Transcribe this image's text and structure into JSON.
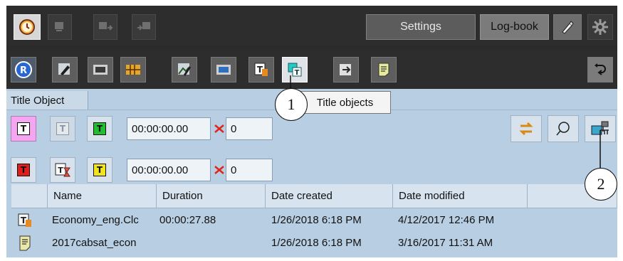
{
  "toolbar_top": {
    "settings_label": "Settings",
    "logbook_label": "Log-book",
    "icons": [
      "clock-icon",
      "monitor-icon",
      "monitor-out-icon",
      "monitor-in-icon",
      "pen-icon",
      "gear-icon"
    ]
  },
  "toolbar_second": {
    "icons": [
      "r-badge-icon",
      "edit-icon",
      "film-icon",
      "template-icon",
      "image-edit-icon",
      "clip-icon",
      "title-object-icon",
      "title-objects-icon",
      "export-icon",
      "notes-icon",
      "undo-arrow-icon"
    ]
  },
  "tooltip": {
    "text": "Title objects"
  },
  "tab": {
    "label": "Title Object"
  },
  "row1": {
    "time": "00:00:00.00",
    "count": "0"
  },
  "row2": {
    "time": "00:00:00.00",
    "count": "0"
  },
  "callouts": [
    "1",
    "2"
  ],
  "table": {
    "columns": [
      "Name",
      "Duration",
      "Date created",
      "Date modified"
    ],
    "rows": [
      {
        "icon": "title-file-icon",
        "name": "Economy_eng.Clc",
        "duration": "00:00:27.88",
        "created": "1/26/2018 6:18 PM",
        "modified": "4/12/2017 12:46 PM"
      },
      {
        "icon": "document-icon",
        "name": "2017cabsat_econ",
        "duration": "",
        "created": "1/26/2018 6:18 PM",
        "modified": "3/16/2017 11:31 AM"
      }
    ]
  },
  "colors": {
    "toolbar_bg": "#2d2d2d",
    "panel_bg": "#b8cfe3",
    "tooltip_bg": "#f4f4f4",
    "pink_button": "#f5a6f0",
    "green_t": "#1fbf2f",
    "red_t": "#e01d1d",
    "yellow_t": "#f2e41c"
  }
}
